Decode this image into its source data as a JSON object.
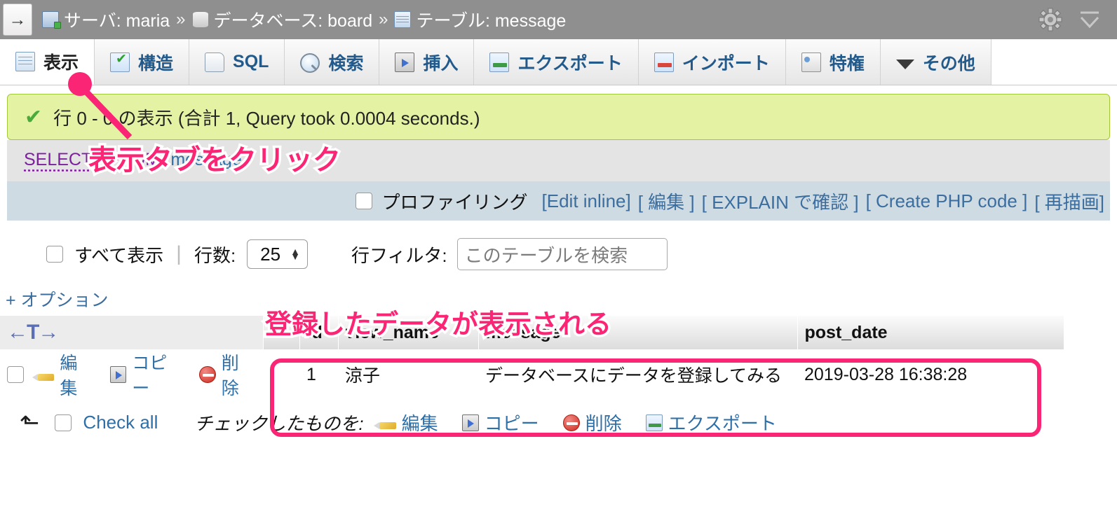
{
  "header": {
    "nav_toggle": "→",
    "breadcrumb": [
      {
        "icon": "server-icon",
        "label": "サーバ: maria"
      },
      {
        "icon": "database-icon",
        "label": "データベース: board"
      },
      {
        "icon": "table-icon",
        "label": "テーブル: message"
      }
    ],
    "separator": "»",
    "actions": [
      {
        "name": "settings-gear-icon",
        "label": "設定"
      },
      {
        "name": "collapse-icon",
        "label": "折りたたむ"
      }
    ]
  },
  "tabs": [
    {
      "id": "browse",
      "label": "表示",
      "icon": "browse-icon",
      "active": true
    },
    {
      "id": "structure",
      "label": "構造",
      "icon": "structure-icon",
      "active": false
    },
    {
      "id": "sql",
      "label": "SQL",
      "icon": "sql-icon",
      "active": false
    },
    {
      "id": "search",
      "label": "検索",
      "icon": "search-icon",
      "active": false
    },
    {
      "id": "insert",
      "label": "挿入",
      "icon": "insert-icon",
      "active": false
    },
    {
      "id": "export",
      "label": "エクスポート",
      "icon": "export-icon",
      "active": false
    },
    {
      "id": "import",
      "label": "インポート",
      "icon": "import-icon",
      "active": false
    },
    {
      "id": "privilege",
      "label": "特権",
      "icon": "privileges-icon",
      "active": false
    },
    {
      "id": "more",
      "label": "その他",
      "icon": "caret-down-icon",
      "active": false
    }
  ],
  "success": {
    "check": "✔",
    "message": "行 0 - 0 の表示 (合計 1, Query took 0.0004 seconds.)"
  },
  "sql": {
    "keyword_select": "SELECT",
    "star": " * ",
    "keyword_from": "FROM",
    "identifier": "`message`"
  },
  "profiling": {
    "label": "プロファイリング",
    "links": [
      "[Edit inline]",
      "[ 編集 ]",
      "[ EXPLAIN で確認 ]",
      "[ Create PHP code ]",
      "[ 再描画]"
    ]
  },
  "controls": {
    "show_all_label": "すべて表示",
    "divider": "|",
    "rows_label": "行数:",
    "rows_value": "25",
    "filter_label": "行フィルタ:",
    "filter_placeholder": "このテーブルを検索",
    "filter_value": ""
  },
  "options_link": "+ オプション",
  "table": {
    "sort_icon": "sort-desc-icon",
    "nav_icon": "←T→",
    "columns": [
      "id",
      "view_name",
      "message",
      "post_date"
    ],
    "rows": [
      {
        "actions": [
          {
            "icon": "pencil-icon",
            "label": "編集"
          },
          {
            "icon": "copy-icon",
            "label": "コピー"
          },
          {
            "icon": "delete-icon",
            "label": "削除"
          }
        ],
        "id": "1",
        "view_name": "涼子",
        "message": "データベースにデータを登録してみる",
        "post_date": "2019-03-28 16:38:28"
      }
    ]
  },
  "bottom": {
    "up_arrow": "⬑",
    "check_all": "Check all",
    "with_selected": "チェックしたものを:",
    "actions": [
      {
        "icon": "pencil-icon",
        "label": "編集"
      },
      {
        "icon": "copy-icon",
        "label": "コピー"
      },
      {
        "icon": "delete-icon",
        "label": "削除"
      },
      {
        "icon": "export-icon",
        "label": "エクスポート"
      }
    ]
  },
  "annotations": [
    {
      "id": "click-tab",
      "text": "表示タブをクリック"
    },
    {
      "id": "data-shown",
      "text": "登録したデータが表示される"
    }
  ],
  "colors": {
    "annotation": "#fb2576",
    "success_bg": "#e4f2a4",
    "success_border": "#a4c639",
    "sql_bg": "#e4e4e4",
    "profiling_bg": "#cfdbe3",
    "breadcrumb_bg": "#8f8f8f",
    "link": "#2e6fa8",
    "keyword": "#7e1f9e"
  }
}
